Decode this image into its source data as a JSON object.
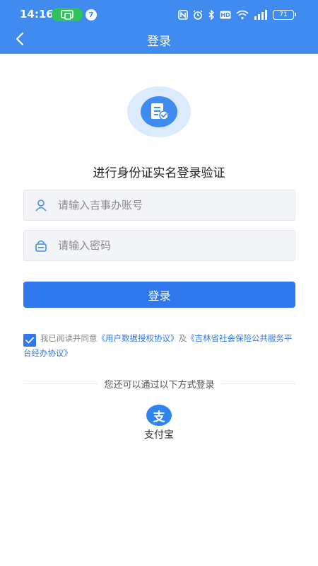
{
  "status_bar": {
    "time": "14:16",
    "notification_count": "7",
    "battery": "71"
  },
  "navbar": {
    "title": "登录"
  },
  "subtitle": "进行身份证实名登录验证",
  "form": {
    "account_placeholder": "请输入吉事办账号",
    "password_placeholder": "请输入密码",
    "login_label": "登录"
  },
  "agreement": {
    "checked": true,
    "prefix": "我已阅读并同意",
    "link1": "《用户数据授权协议》",
    "and": "及",
    "link2": "《吉林省社会保险公共服务平台经办协议》"
  },
  "alt_login": {
    "divider_text": "您还可以通过以下方式登录",
    "alipay_logo": "支",
    "alipay_label": "支付宝"
  },
  "colors": {
    "brand": "#3f8bf0",
    "button": "#2f78ee",
    "status_pill": "#2fc45b"
  },
  "icons": [
    "back-arrow-icon",
    "document-check-icon",
    "user-icon",
    "lock-icon",
    "checkmark-icon",
    "alipay-icon",
    "nfc-icon",
    "alarm-icon",
    "bluetooth-icon",
    "hd-icon",
    "wifi-icon",
    "signal-icon",
    "battery-icon"
  ]
}
